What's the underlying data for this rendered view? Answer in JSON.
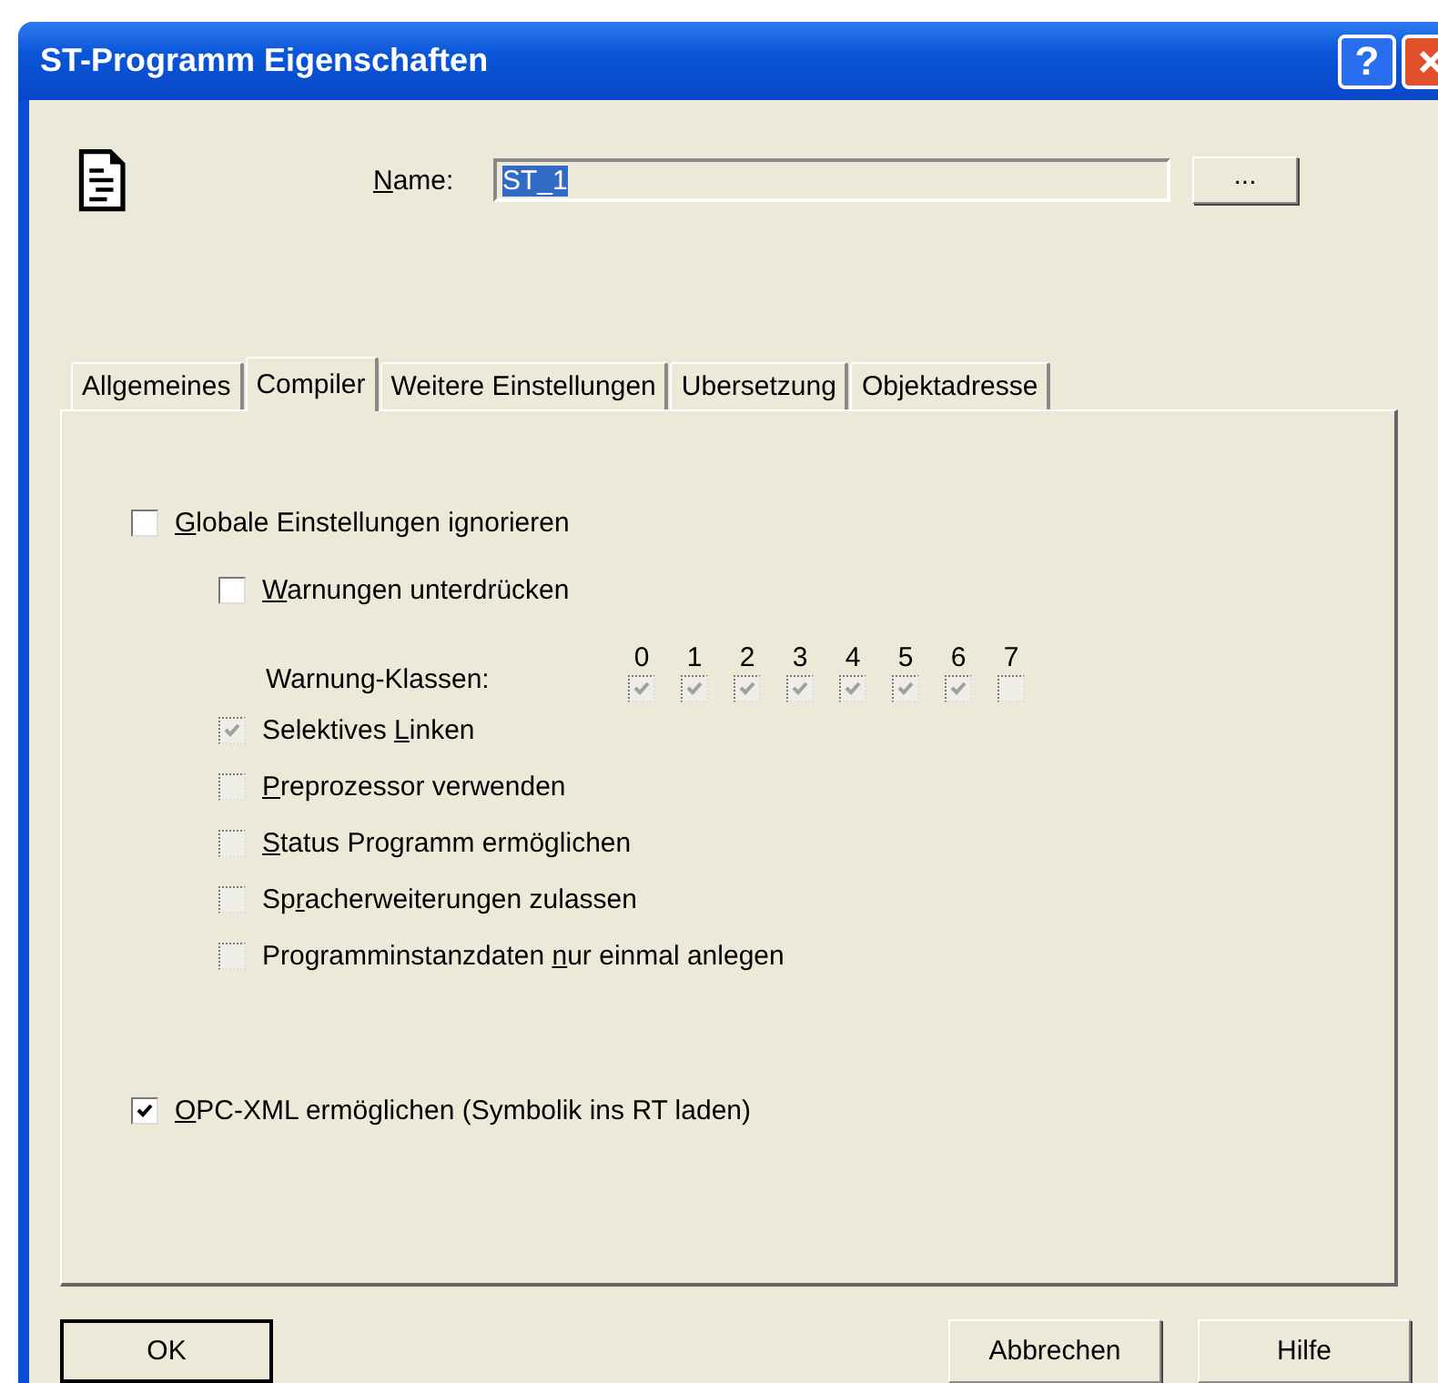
{
  "window": {
    "title": "ST-Programm Eigenschaften",
    "help_button": "?"
  },
  "name_field": {
    "label_parts": {
      "key": "N",
      "after": "ame:"
    },
    "value": "ST_1",
    "value_selected": true
  },
  "browse_button": "...",
  "tabs": [
    {
      "label": "Allgemeines",
      "selected": false
    },
    {
      "label": "Compiler",
      "selected": true
    },
    {
      "label": "Weitere Einstellungen",
      "selected": false
    },
    {
      "label": "Ubersetzung",
      "selected": false
    },
    {
      "label": "Objektadresse",
      "selected": false
    }
  ],
  "options": [
    {
      "kind": "checkbox",
      "label_parts": {
        "key": "G",
        "after": "lobale Einstellungen ignorieren"
      },
      "checked": false,
      "disabled": false,
      "children": [
        {
          "kind": "checkbox",
          "label_parts": {
            "key": "W",
            "after": "arnungen unterdrücken"
          },
          "checked": false,
          "disabled": false
        },
        {
          "kind": "classes",
          "label": "Warnung-Klassen:",
          "classes": [
            {
              "digit": "0",
              "checked": true,
              "disabled": true
            },
            {
              "digit": "1",
              "checked": true,
              "disabled": true
            },
            {
              "digit": "2",
              "checked": true,
              "disabled": true
            },
            {
              "digit": "3",
              "checked": true,
              "disabled": true
            },
            {
              "digit": "4",
              "checked": true,
              "disabled": true
            },
            {
              "digit": "5",
              "checked": true,
              "disabled": true
            },
            {
              "digit": "6",
              "checked": true,
              "disabled": true
            },
            {
              "digit": "7",
              "checked": false,
              "disabled": true
            }
          ]
        },
        {
          "kind": "checkbox",
          "label_parts": {
            "before": "Selektives ",
            "key": "L",
            "after": "inken"
          },
          "checked": true,
          "disabled": true
        },
        {
          "kind": "checkbox",
          "label_parts": {
            "key": "P",
            "after": "reprozessor verwenden"
          },
          "checked": false,
          "disabled": true
        },
        {
          "kind": "checkbox",
          "label_parts": {
            "key": "S",
            "after": "tatus Programm ermöglichen"
          },
          "checked": false,
          "disabled": true
        },
        {
          "kind": "checkbox",
          "label_parts": {
            "before": "Sp",
            "key": "r",
            "after": "acherweiterungen zulassen"
          },
          "checked": false,
          "disabled": true
        },
        {
          "kind": "checkbox",
          "label_parts": {
            "before": "Programminstanzdaten ",
            "key": "n",
            "after": "ur einmal anlegen"
          },
          "checked": false,
          "disabled": true
        }
      ]
    },
    {
      "kind": "checkbox",
      "label_parts": {
        "key": "O",
        "after": "PC-XML ermöglichen (Symbolik ins RT laden)"
      },
      "checked": true,
      "disabled": false
    }
  ],
  "buttons": [
    {
      "label": "OK",
      "default": true
    },
    {
      "label": "Abbrechen",
      "default": false
    },
    {
      "label": "Hilfe",
      "default": false
    }
  ]
}
